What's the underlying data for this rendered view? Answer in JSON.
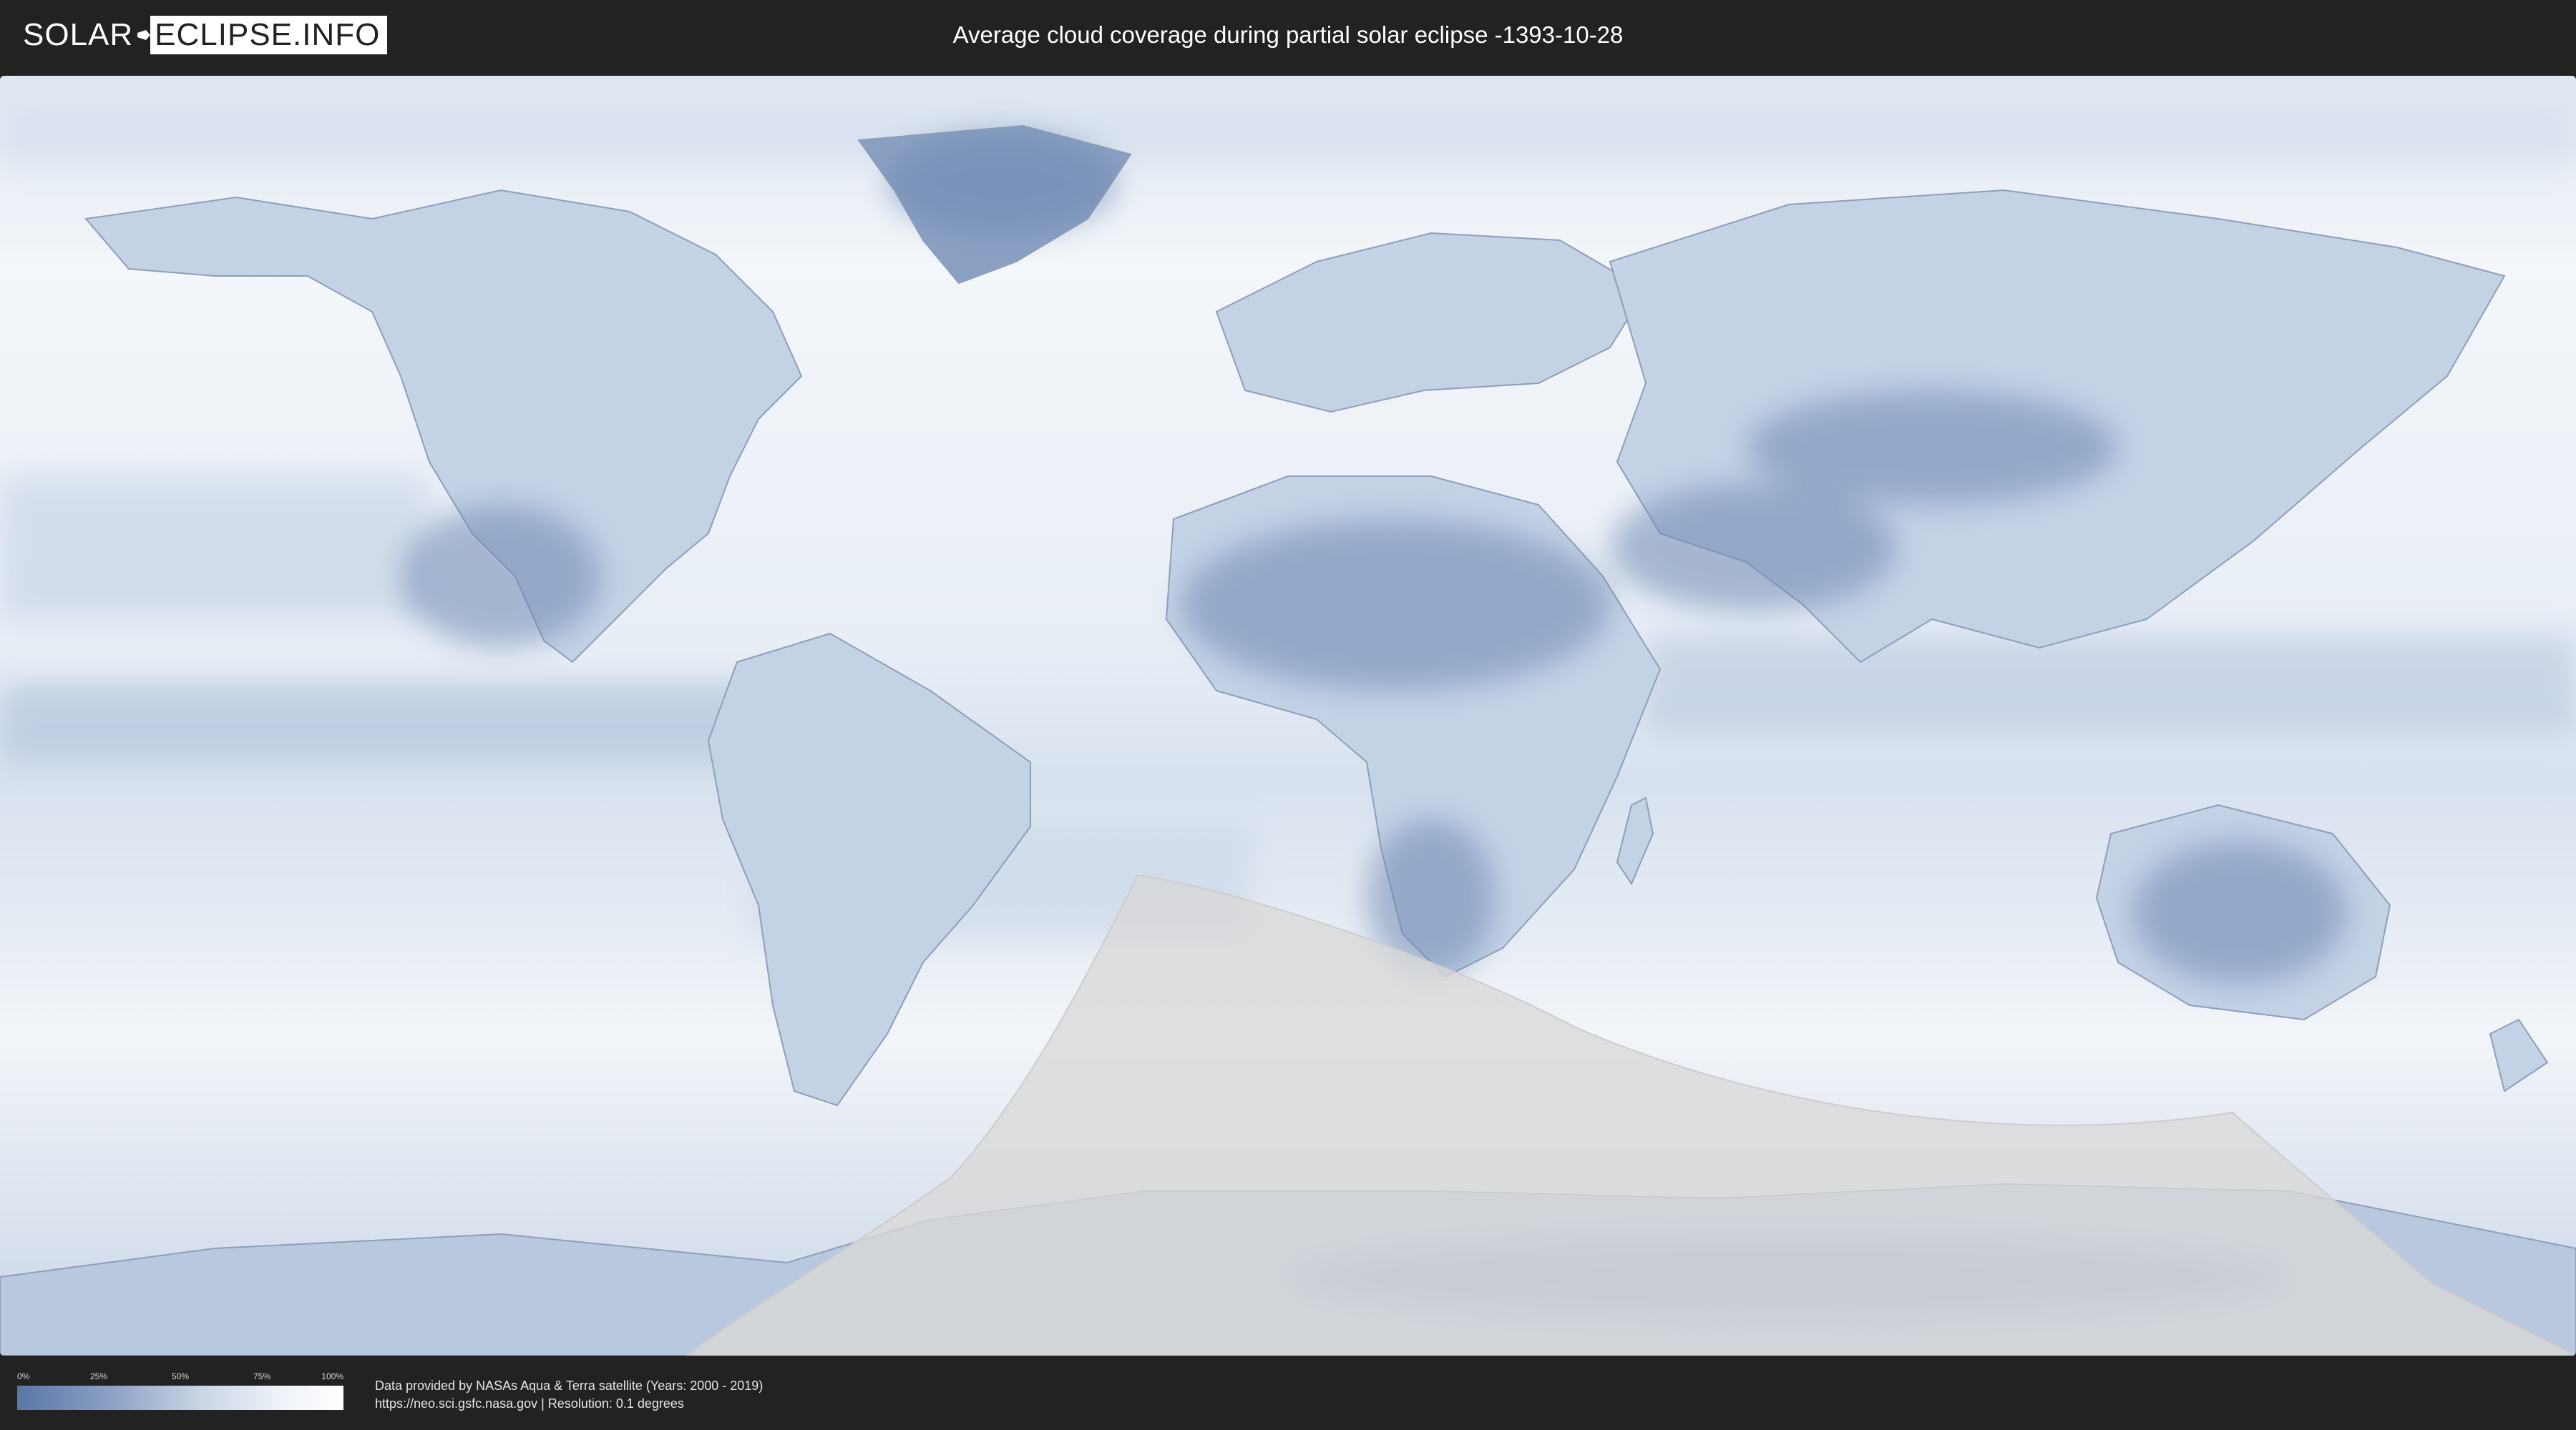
{
  "header": {
    "logo_left": "SOLAR",
    "logo_right": "ECLIPSE.INFO",
    "title": "Average cloud coverage during partial solar eclipse -1393-10-28"
  },
  "map": {
    "background_color": "#eef2f8",
    "land_cloud_dark": "#5a76a6",
    "eclipse_zone_color": "#d9d9d9"
  },
  "footer": {
    "legend": {
      "ticks": [
        "0%",
        "25%",
        "50%",
        "75%",
        "100%"
      ],
      "gradient_colors": [
        "#5a76a6",
        "#8ea3c6",
        "#c7d3e4",
        "#eef2f8",
        "#ffffff"
      ]
    },
    "source_line1": "Data provided by NASAs Aqua & Terra satellite (Years: 2000 - 2019)",
    "source_line2": "https://neo.sci.gsfc.nasa.gov | Resolution: 0.1 degrees"
  }
}
